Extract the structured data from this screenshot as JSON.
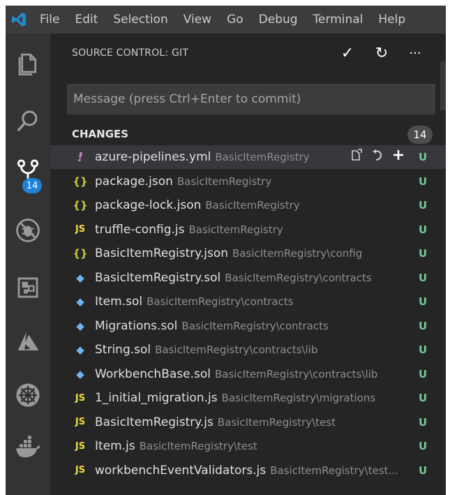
{
  "menu": [
    "File",
    "Edit",
    "Selection",
    "View",
    "Go",
    "Debug",
    "Terminal",
    "Help"
  ],
  "activity_icons": [
    "explorer-icon",
    "search-icon",
    "source-control-icon",
    "debug-icon",
    "extensions-icon",
    "azure-icon",
    "kubernetes-icon",
    "docker-icon"
  ],
  "scm_badge": "14",
  "sidebar": {
    "title": "SOURCE CONTROL: GIT",
    "commit_icon": "✓",
    "refresh_icon": "↻",
    "more_icon": "···",
    "message_placeholder": "Message (press Ctrl+Enter to commit)",
    "changes_label": "CHANGES",
    "changes_count": "14"
  },
  "changes": [
    {
      "icon": "!",
      "icon_type": "yaml",
      "name": "azure-pipelines.yml",
      "path": "BasicItemRegistry",
      "status": "U"
    },
    {
      "icon": "{}",
      "icon_type": "json",
      "name": "package.json",
      "path": "BasicItemRegistry",
      "status": "U"
    },
    {
      "icon": "{}",
      "icon_type": "json",
      "name": "package-lock.json",
      "path": "BasicItemRegistry",
      "status": "U"
    },
    {
      "icon": "JS",
      "icon_type": "js",
      "name": "truffle-config.js",
      "path": "BasicItemRegistry",
      "status": "U"
    },
    {
      "icon": "{}",
      "icon_type": "json",
      "name": "BasicItemRegistry.json",
      "path": "BasicItemRegistry\\config",
      "status": "U"
    },
    {
      "icon": "◆",
      "icon_type": "sol",
      "name": "BasicItemRegistry.sol",
      "path": "BasicItemRegistry\\contracts",
      "status": "U"
    },
    {
      "icon": "◆",
      "icon_type": "sol",
      "name": "Item.sol",
      "path": "BasicItemRegistry\\contracts",
      "status": "U"
    },
    {
      "icon": "◆",
      "icon_type": "sol",
      "name": "Migrations.sol",
      "path": "BasicItemRegistry\\contracts",
      "status": "U"
    },
    {
      "icon": "◆",
      "icon_type": "sol",
      "name": "String.sol",
      "path": "BasicItemRegistry\\contracts\\lib",
      "status": "U"
    },
    {
      "icon": "◆",
      "icon_type": "sol",
      "name": "WorkbenchBase.sol",
      "path": "BasicItemRegistry\\contracts\\lib",
      "status": "U"
    },
    {
      "icon": "JS",
      "icon_type": "js",
      "name": "1_initial_migration.js",
      "path": "BasicItemRegistry\\migrations",
      "status": "U"
    },
    {
      "icon": "JS",
      "icon_type": "js",
      "name": "BasicItemRegistry.js",
      "path": "BasicItemRegistry\\test",
      "status": "U"
    },
    {
      "icon": "JS",
      "icon_type": "js",
      "name": "Item.js",
      "path": "BasicItemRegistry\\test",
      "status": "U"
    },
    {
      "icon": "JS",
      "icon_type": "js",
      "name": "workbenchEventValidators.js",
      "path": "BasicItemRegistry\\test...",
      "status": "U"
    }
  ],
  "colors": {
    "yaml": "#c586c0",
    "json": "#cbcb41",
    "js": "#f1dd3f",
    "sol": "#6fb3f2",
    "untracked": "#73c991",
    "badge": "#1e82d8"
  }
}
